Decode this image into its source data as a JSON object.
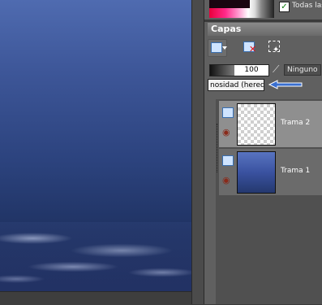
{
  "panel": {
    "checkbox_label": "Todas las",
    "title": "Capas",
    "opacity_value": "100",
    "mask_mode": "Ninguno",
    "blend_mode": "nosidad (hered"
  },
  "layers": [
    {
      "name": "Trama 2",
      "selected": true,
      "thumb": "transparent"
    },
    {
      "name": "Trama 1",
      "selected": false,
      "thumb": "blue-gradient"
    }
  ],
  "colors": {
    "canvas_top": "#4f6bb0",
    "canvas_bottom": "#1a2a55",
    "panel_bg": "#606060",
    "arrow": "#3a6fd0"
  },
  "icons": [
    "new-layer-icon",
    "delete-layer-icon",
    "layer-selection-icon",
    "link-icon",
    "layer-type-icon",
    "eye-icon",
    "arrow-icon"
  ]
}
